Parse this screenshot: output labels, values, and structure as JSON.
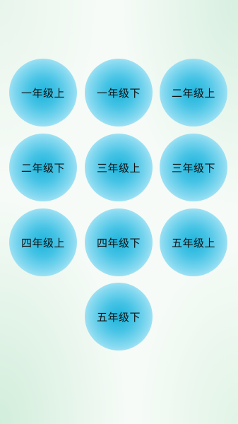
{
  "grades": [
    {
      "label": "一年级上"
    },
    {
      "label": "一年级下"
    },
    {
      "label": "二年级上"
    },
    {
      "label": "二年级下"
    },
    {
      "label": "三年级上"
    },
    {
      "label": "三年级下"
    },
    {
      "label": "四年级上"
    },
    {
      "label": "四年级下"
    },
    {
      "label": "五年级上"
    },
    {
      "label": "五年级下"
    }
  ],
  "colors": {
    "button_center": "#1fb4db",
    "button_edge": "#dff6fd",
    "background": "#f6fbf7",
    "text": "#111111"
  }
}
